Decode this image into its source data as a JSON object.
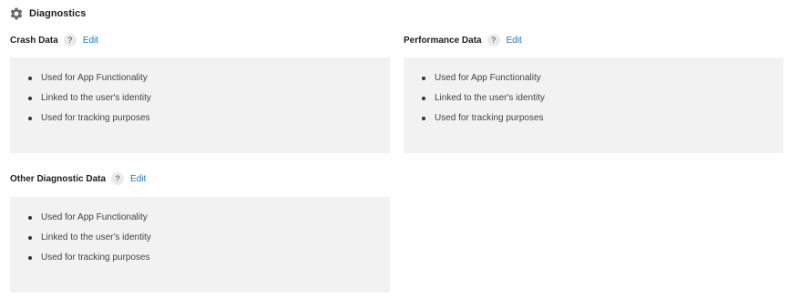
{
  "section": {
    "title": "Diagnostics",
    "icon": "gear-icon"
  },
  "cards": [
    {
      "title": "Crash Data",
      "help": "?",
      "edit_label": "Edit",
      "items": [
        "Used for App Functionality",
        "Linked to the user's identity",
        "Used for tracking purposes"
      ]
    },
    {
      "title": "Performance Data",
      "help": "?",
      "edit_label": "Edit",
      "items": [
        "Used for App Functionality",
        "Linked to the user's identity",
        "Used for tracking purposes"
      ]
    },
    {
      "title": "Other Diagnostic Data",
      "help": "?",
      "edit_label": "Edit",
      "items": [
        "Used for App Functionality",
        "Linked to the user's identity",
        "Used for tracking purposes"
      ]
    }
  ],
  "colors": {
    "link": "#1c75bc",
    "card_bg": "#f2f2f2"
  }
}
